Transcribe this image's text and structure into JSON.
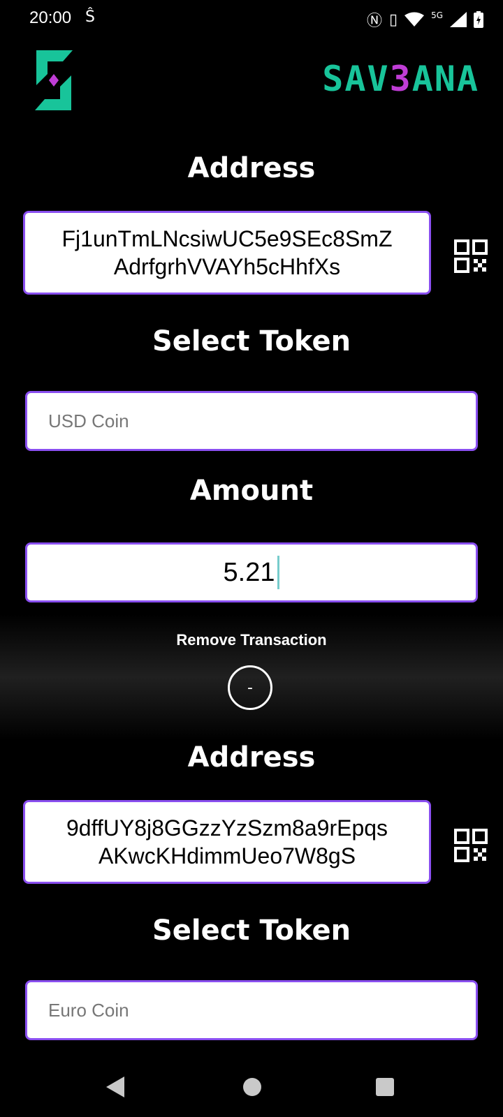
{
  "status_bar": {
    "time": "20:00",
    "network": "5G",
    "icons": [
      "nfc-icon",
      "vibrate-icon",
      "wifi-icon",
      "signal-icon",
      "battery-charging-icon"
    ]
  },
  "header": {
    "brand_left": "SAV",
    "brand_mid": "3",
    "brand_right": "ANA",
    "brand_color": "#18c49a",
    "brand_accent": "#c03dd6"
  },
  "transaction1": {
    "address_label": "Address",
    "address_line1": "Fj1unTmLNcsiwUC5e9SEc8SmZ",
    "address_line2": "AdrfgrhVVAYh5cHhfXs",
    "token_label": "Select Token",
    "token_value": "USD Coin",
    "amount_label": "Amount",
    "amount_value": "5.21"
  },
  "remove": {
    "label": "Remove Transaction",
    "button": "-"
  },
  "transaction2": {
    "address_label": "Address",
    "address_line1": "9dffUY8j8GGzzYzSzm8a9rEpqs",
    "address_line2": "AKwcKHdimmUeo7W8gS",
    "token_label": "Select Token",
    "token_value": "Euro Coin"
  },
  "colors": {
    "field_border": "#8a4ff0",
    "background": "#000000"
  }
}
